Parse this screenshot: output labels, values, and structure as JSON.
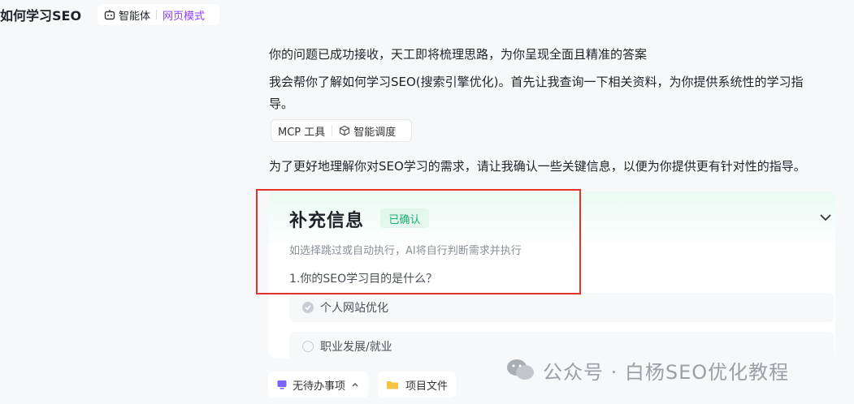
{
  "header": {
    "title": "如何学习SEO",
    "agent_label": "智能体",
    "mode_label": "网页模式"
  },
  "messages": {
    "line1": "你的问题已成功接收，天工即将梳理思路，为你呈现全面且精准的答案",
    "line2a": "我会帮你了解如何学习SEO(搜索引擎优化)。首先让我查询一下相关资料，为你提供系统性的学习指",
    "line2b": "导。",
    "line3": "为了更好地理解你对SEO学习的需求，请让我确认一些关键信息，以便为你提供更有针对性的指导。"
  },
  "tools": {
    "mcp_label": "MCP 工具",
    "schedule_label": "智能调度"
  },
  "card": {
    "title": "补充信息",
    "status_badge": "已确认",
    "hint": "如选择跳过或自动执行，AI将自行判断需求并执行",
    "question": "1.你的SEO学习目的是什么？",
    "options": [
      {
        "label": "个人网站优化",
        "selected": true
      },
      {
        "label": "职业发展/就业",
        "selected": false
      }
    ]
  },
  "bottom": {
    "todo_label": "无待办事项",
    "files_label": "项目文件"
  },
  "watermark": {
    "text": "公众号 · 白杨SEO优化教程"
  },
  "colors": {
    "accent_purple": "#8a3ffc",
    "confirm_green": "#1aae6f",
    "highlight_red": "#e5312e"
  },
  "icons": {
    "agent": "robot-icon",
    "schedule": "cube-icon",
    "expand": "chevron-down-icon",
    "todo": "monitor-icon",
    "files": "folder-icon",
    "watermark": "wechat-icon"
  }
}
